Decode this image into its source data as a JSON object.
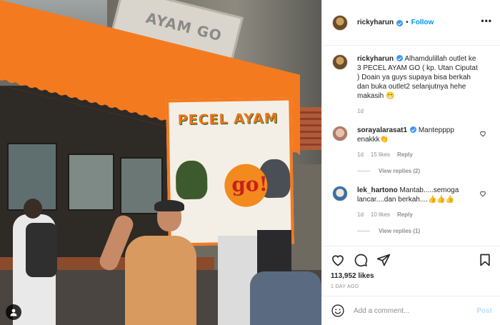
{
  "post": {
    "author": "rickyharun",
    "follow_label": "Follow",
    "more_label": "•••",
    "separator": "•",
    "caption": "Alhamdulillah outlet ke 3 PECEL AYAM GO ( kp. Utan Ciputat ) Doain ya guys supaya bisa berkah dan buka outlet2 selanjutnya hehe makasih 😁",
    "caption_age": "1d",
    "likes": "113,952 likes",
    "date": "1 DAY AGO"
  },
  "photo": {
    "banner_title": "PECEL AYAM",
    "banner_logo": "go!",
    "wall_sign": "AYAM GO"
  },
  "comments": [
    {
      "user": "sorayalarasat1",
      "text": "Mantepppp enakkk👏",
      "age": "1d",
      "likes": "15 likes",
      "reply": "Reply",
      "view_replies": "View replies (2)"
    },
    {
      "user": "lek_hartono",
      "text": "Mantab.....semoga lancar....dan berkah....👍👍👍",
      "age": "1d",
      "likes": "10 likes",
      "reply": "Reply",
      "view_replies": "View replies (1)"
    }
  ],
  "composer": {
    "placeholder": "Add a comment...",
    "post_label": "Post"
  },
  "icons": [
    "heart-icon",
    "comment-icon",
    "share-icon",
    "bookmark-icon",
    "emoji-icon",
    "more-icon",
    "user-tag-icon",
    "verified-badge"
  ],
  "colors": {
    "accent": "#0095f6",
    "verified": "#3897f0",
    "post_disabled": "#b2dffc",
    "muted": "#8e8e8e"
  }
}
